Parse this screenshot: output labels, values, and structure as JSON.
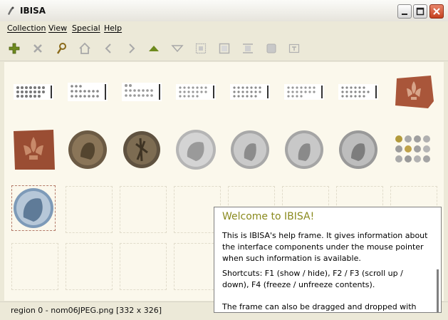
{
  "window": {
    "title": "IBISA"
  },
  "menu": [
    "Collection",
    "View",
    "Special",
    "Help"
  ],
  "toolbar": [
    {
      "name": "add-icon"
    },
    {
      "name": "delete-icon"
    },
    {
      "name": "search-icon"
    },
    {
      "name": "home-icon"
    },
    {
      "name": "back-icon"
    },
    {
      "name": "forward-icon"
    },
    {
      "name": "up-icon"
    },
    {
      "name": "down-icon"
    },
    {
      "name": "frame-icon"
    },
    {
      "name": "crop-icon"
    },
    {
      "name": "expand-icon"
    },
    {
      "name": "stop-icon"
    },
    {
      "name": "text-icon"
    }
  ],
  "status": {
    "text": "region 0 - nom06JPEG.png [332 x 326]"
  },
  "help": {
    "title": "Welcome to IBISA!",
    "paragraph1": "This is IBISA's help frame. It gives information about the interface components under the mouse pointer when such information is available.",
    "paragraph2": "Shortcuts: F1 (show / hide), F2 / F3 (scroll up / down), F4 (freeze / unfreeze contents).",
    "paragraph3": "The frame can also be dragged and dropped with the"
  },
  "thumbnails": [
    "coin-plate-grid",
    "coin-plate-grid",
    "coin-plate-grid",
    "coin-plate-grid",
    "coin-plate-grid",
    "coin-plate-grid",
    "coin-plate-grid",
    "fleur-de-lis-tile",
    "fleur-de-lis-tile",
    "bronze-coin",
    "bronze-coin",
    "silver-coin",
    "silver-coin",
    "silver-coin",
    "silver-coin",
    "coin-set",
    "silver-coin-selected"
  ]
}
